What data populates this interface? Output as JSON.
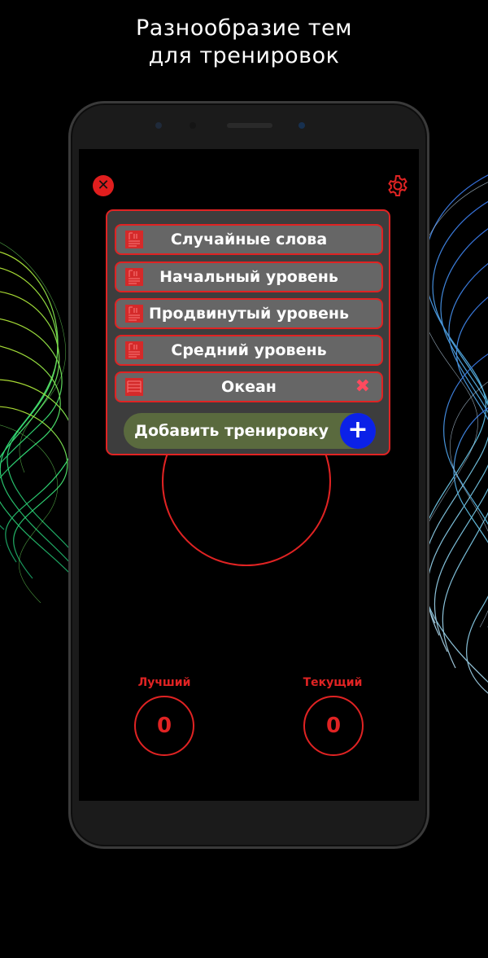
{
  "promo": {
    "line1": "Разнообразие тем",
    "line2": "для тренировок"
  },
  "colors": {
    "accent_red": "#e02323",
    "panel_bg": "#3d3d3d",
    "row_bg": "#666666",
    "add_bg": "#5a6a3e",
    "plus_blue": "#0b21e8",
    "delete_pink": "#ff4a5e"
  },
  "toolbar": {
    "close_icon": "close-icon",
    "settings_icon": "gear-icon"
  },
  "workouts": [
    {
      "label": "Случайные слова",
      "icon": "document-icon"
    },
    {
      "label": "Начальный уровень",
      "icon": "document-icon"
    },
    {
      "label": "Продвинутый уровень",
      "icon": "document-icon"
    },
    {
      "label": "Средний уровень",
      "icon": "document-icon"
    },
    {
      "label": "Океан",
      "icon": "document-icon",
      "deletable": true
    }
  ],
  "add_workout": {
    "label": "Добавить тренировку",
    "icon": "plus-icon"
  },
  "scores": {
    "best_label": "Лучший",
    "best_value": "0",
    "current_label": "Текущий",
    "current_value": "0"
  }
}
